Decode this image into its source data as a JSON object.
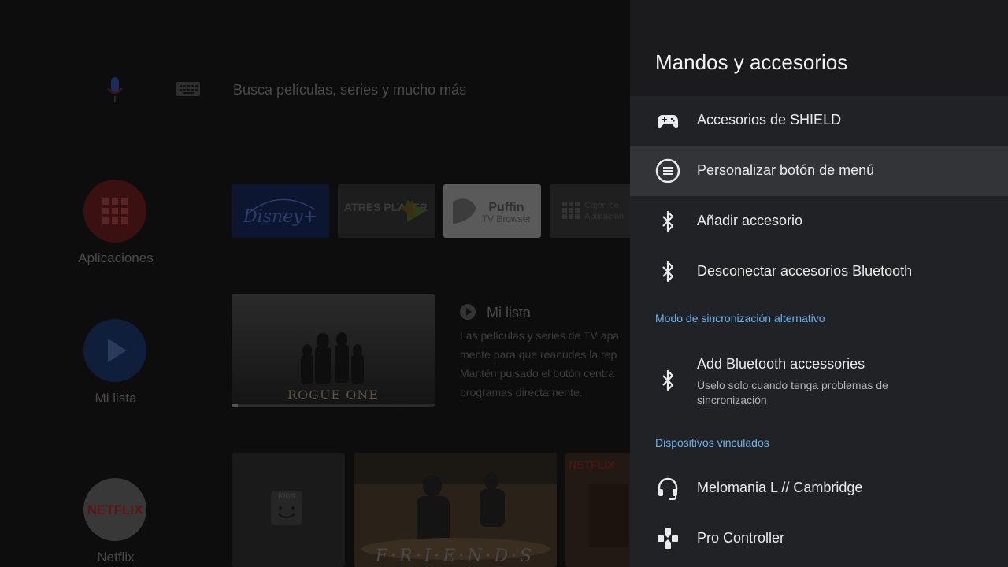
{
  "background": {
    "search": {
      "placeholder_text": "Busca películas, series y mucho más"
    },
    "side_nav": [
      {
        "label": "Aplicaciones",
        "icon": "apps-grid-icon",
        "color": "#5a1a1a"
      },
      {
        "label": "Mi lista",
        "icon": "play-icon",
        "color": "#142646"
      },
      {
        "label": "Netflix",
        "icon": "netflix-logo",
        "color": "#4a4a4a"
      }
    ],
    "apps_row": [
      {
        "name": "Disney+",
        "text": "Disney+"
      },
      {
        "name": "ATRESplayer",
        "text": "ATRES PLAYER"
      },
      {
        "name": "Puffin TV Browser",
        "text_1": "Puffin",
        "text_2": "TV Browser"
      },
      {
        "name": "Cajón de Aplicaciones",
        "text": "Cajón de Aplicacion"
      }
    ],
    "mylist_card": {
      "title_art": "ROGUE ONE"
    },
    "mylist": {
      "title": "Mi lista",
      "description_lines": [
        "Las películas y series de TV apa",
        "mente para que reanudes la rep",
        "Mantén pulsado el botón centra",
        "programas directamente."
      ]
    },
    "netflix_row": [
      {
        "name": "KIDS",
        "text": "KIDS"
      },
      {
        "name": "Friends",
        "text": "F·R·I·E·N·D·S"
      },
      {
        "name": "Netflix title",
        "text": "NETFLIX"
      }
    ]
  },
  "panel": {
    "title": "Mandos y accesorios",
    "items": [
      {
        "label": "Accesorios de SHIELD",
        "icon": "gamepad-icon"
      },
      {
        "label": "Personalizar botón de menú",
        "icon": "menu-button-icon",
        "focused": true
      },
      {
        "label": "Añadir accesorio",
        "icon": "bluetooth-icon"
      },
      {
        "label": "Desconectar accesorios Bluetooth",
        "icon": "bluetooth-icon"
      }
    ],
    "section_sync": "Modo de sincronización alternativo",
    "alt_item": {
      "label": "Add Bluetooth accessories",
      "sublabel": "Úselo solo cuando tenga problemas de sincronización",
      "icon": "bluetooth-icon"
    },
    "section_devices": "Dispositivos vinculados",
    "devices": [
      {
        "label": "Melomania L // Cambridge",
        "icon": "headset-icon"
      },
      {
        "label": "Pro Controller",
        "icon": "dpad-icon"
      }
    ],
    "accent_color": "#6ab3f2"
  }
}
